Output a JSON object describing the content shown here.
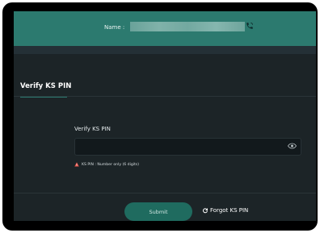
{
  "header": {
    "name_label": "Name :",
    "phone_icon": "phone-icon"
  },
  "section": {
    "title": "Verify KS PIN"
  },
  "form": {
    "pin_label": "Verify KS PIN",
    "pin_value": "",
    "eye_icon": "eye-icon",
    "hint_icon": "warning-triangle-icon",
    "hint_text": "KS PIN : Number only (6 digits)",
    "submit_label": "Submit",
    "forgot_icon": "refresh-icon",
    "forgot_label": "Forgot KS PIN"
  },
  "colors": {
    "header": "#2c7a6f",
    "background": "#1c2427",
    "submit": "#1f6b5f",
    "warning": "#e8534a"
  }
}
